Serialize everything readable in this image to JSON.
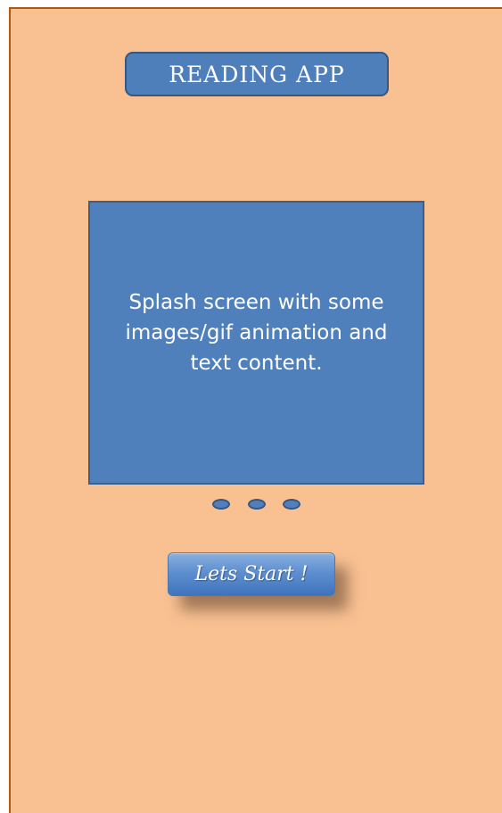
{
  "app": {
    "title": "READING APP"
  },
  "splash": {
    "text": "Splash screen with some images/gif animation and text content."
  },
  "pager": {
    "count": 3
  },
  "actions": {
    "start_label": "Lets Start !"
  },
  "colors": {
    "background": "#f9c192",
    "accent": "#4f80bb",
    "border": "#b15a10"
  }
}
